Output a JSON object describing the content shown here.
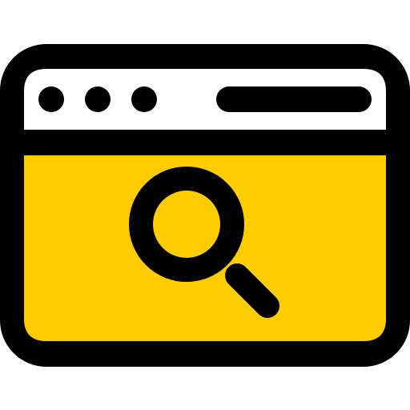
{
  "icon": {
    "name": "browser-search-icon",
    "parts": [
      "browser-window",
      "title-bar",
      "window-dots",
      "address-bar",
      "content-area",
      "magnifying-glass-icon"
    ]
  },
  "colors": {
    "outline": "#000000",
    "title_bar": "#ffffff",
    "content": "#ffcc00",
    "lens": "#ffcc00"
  }
}
